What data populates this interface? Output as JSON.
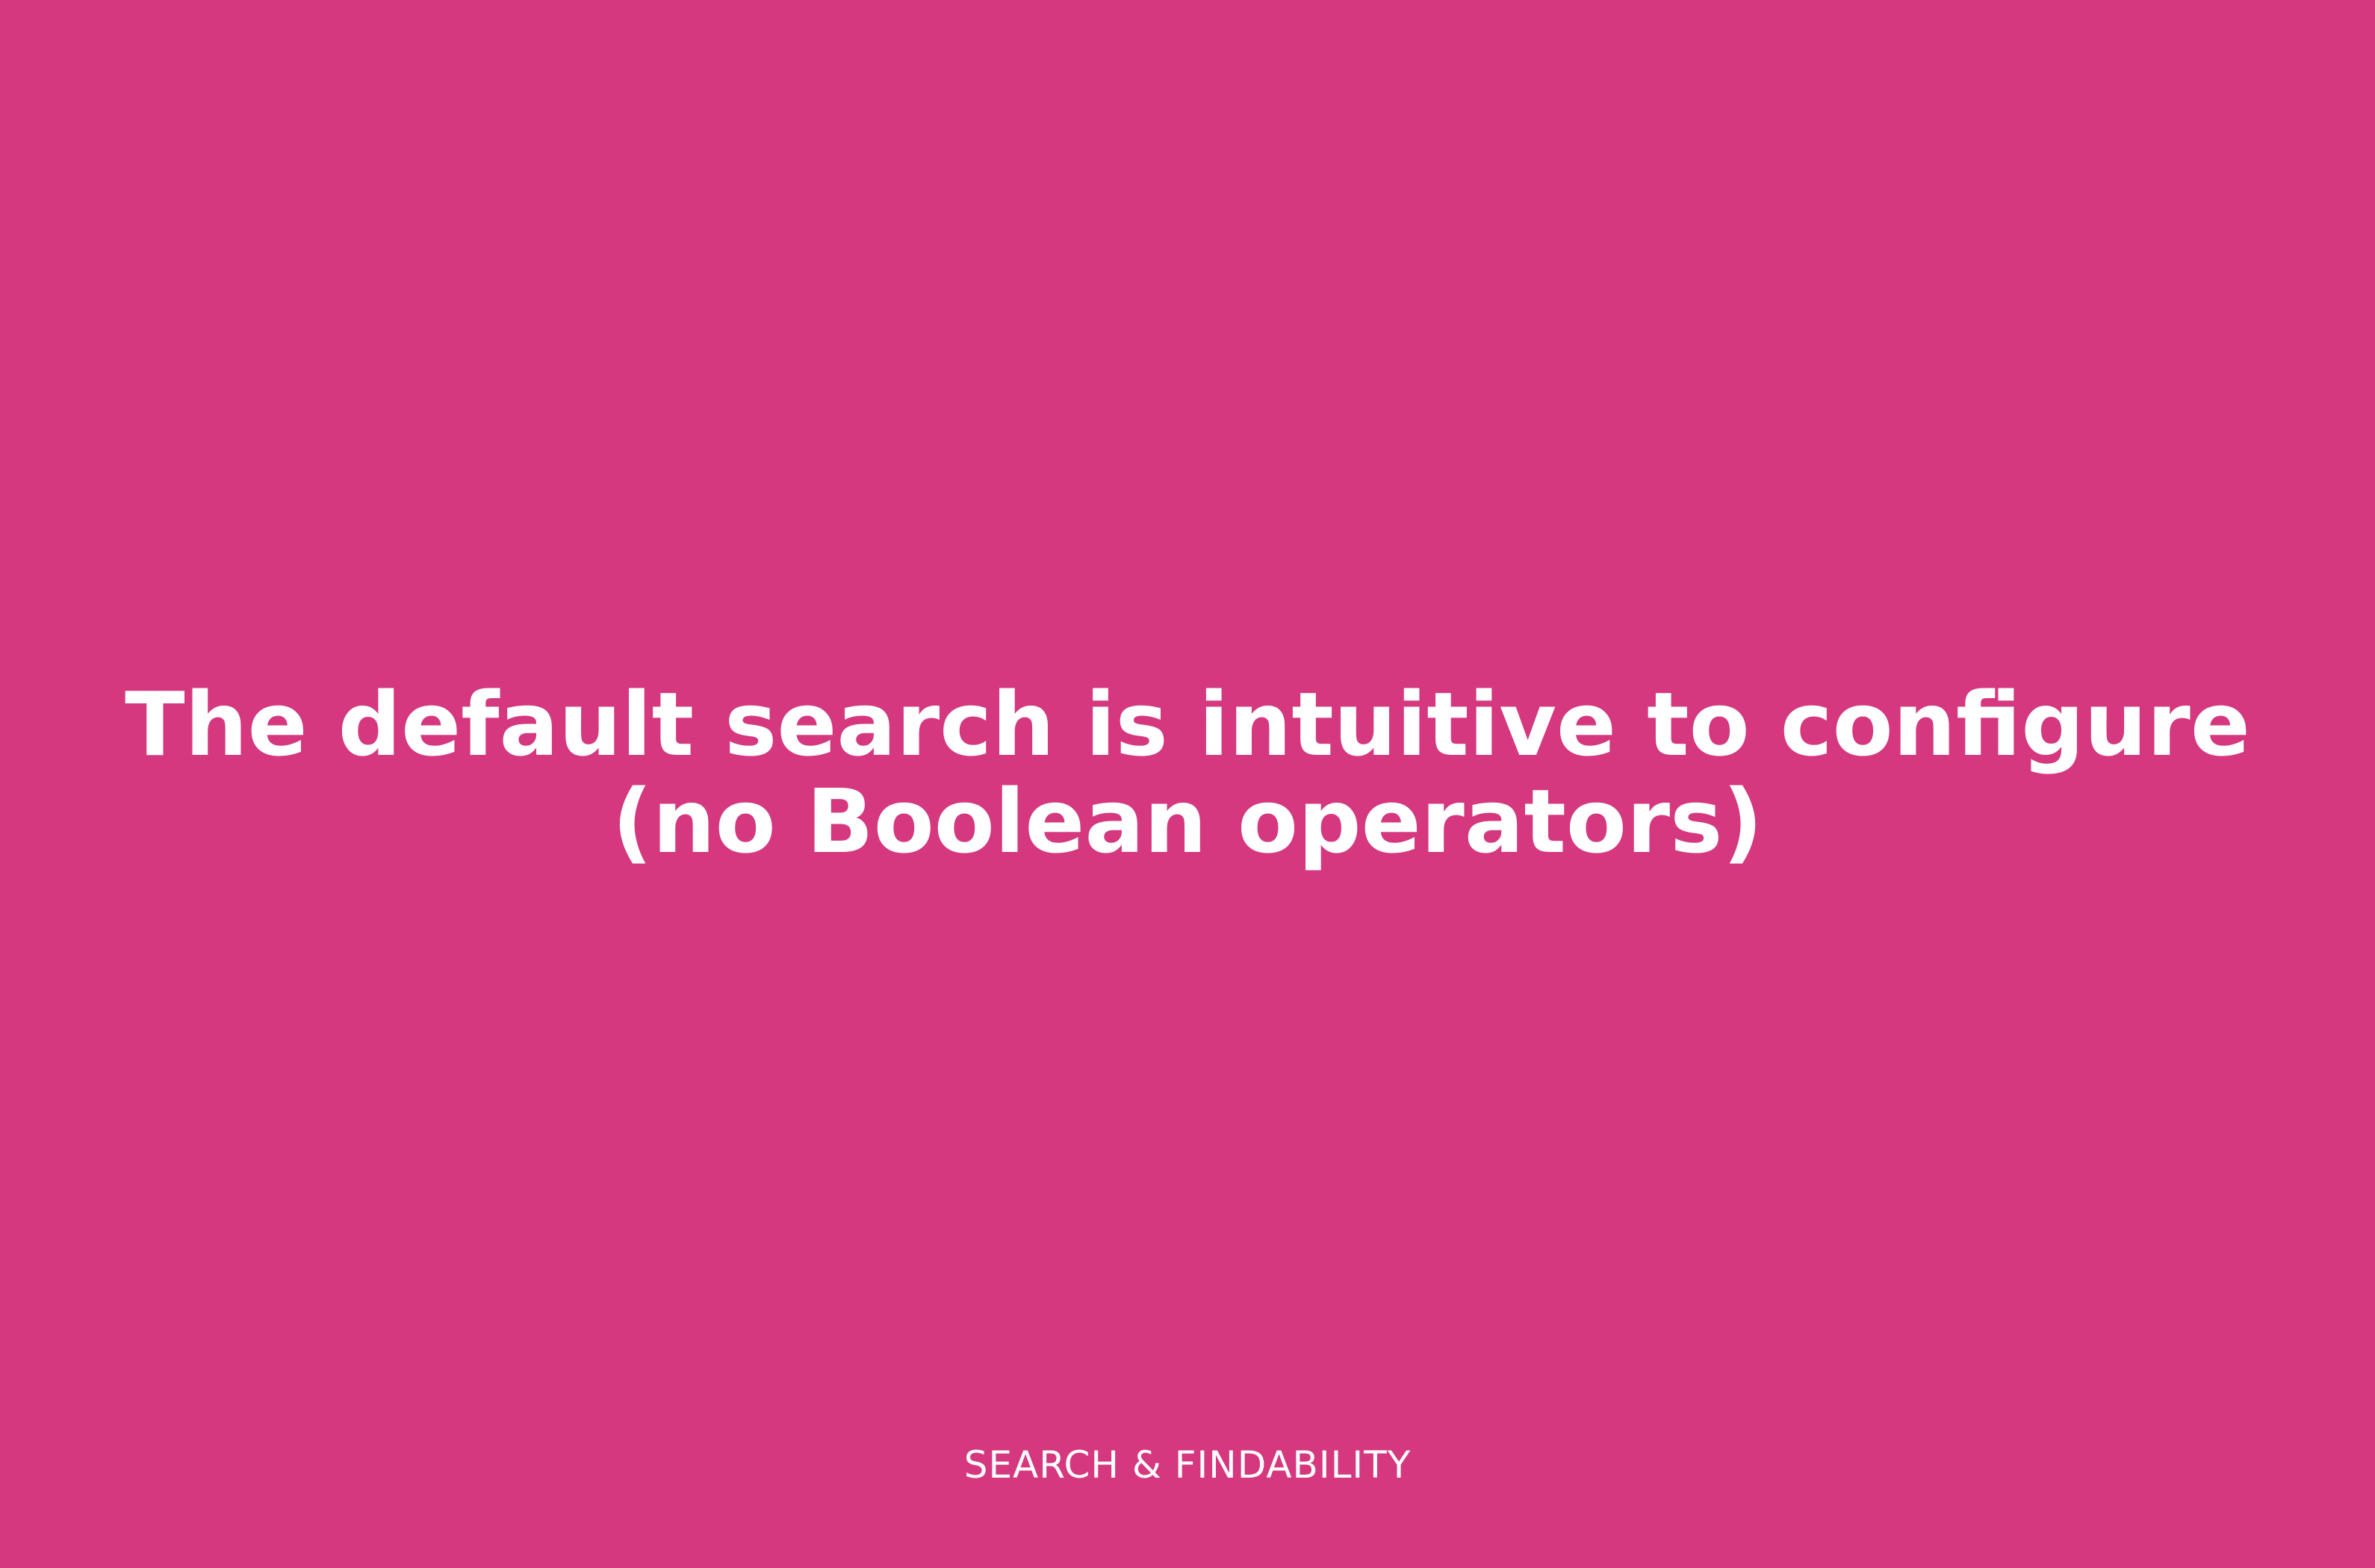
{
  "slide": {
    "headline_line1": "The default search is intuitive to configure",
    "headline_line2": "(no Boolean operators)",
    "category": "SEARCH & FINDABILITY",
    "background_color": "#d5387f",
    "text_color": "#ffffff"
  }
}
